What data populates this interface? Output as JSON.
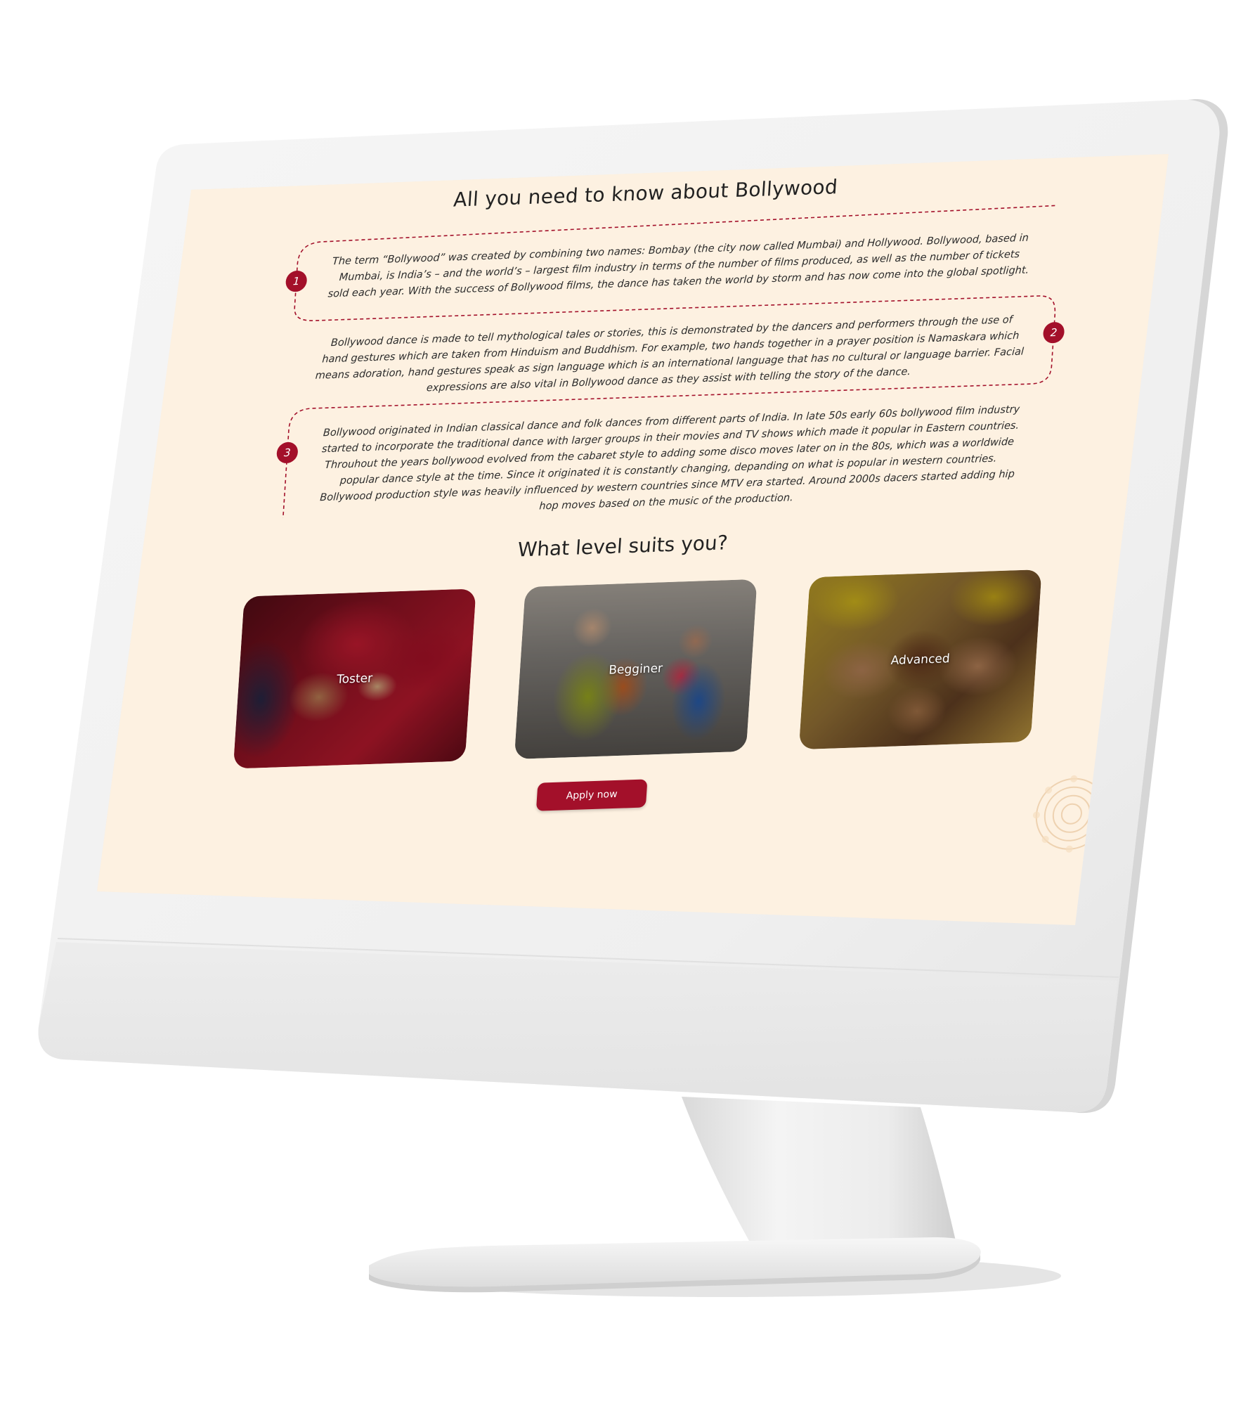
{
  "colors": {
    "background": "#fdf1e1",
    "accent": "#a3102a",
    "text": "#2b2b2b",
    "monitor": "#f1f1f1"
  },
  "page": {
    "title": "All you need to know about Bollywood",
    "steps": [
      {
        "number": "1",
        "text": "The term “Bollywood” was created by combining two names: Bombay (the city now called Mumbai) and Hollywood. Bollywood, based in Mumbai, is India’s – and the world’s – largest film industry in terms of the number of films produced, as well as the number of tickets sold each year. With the success of Bollywood films, the dance has taken the world by storm and has now come into the global spotlight."
      },
      {
        "number": "2",
        "text": "Bollywood dance is made to tell mythological tales or stories, this is demonstrated by the dancers and performers through the use of hand gestures which are taken from Hinduism and Buddhism. For example, two hands together in a prayer position is Namaskara which means adoration, hand gestures speak as sign language which is an international language that has no cultural or language barrier. Facial expressions are also vital in Bollywood dance as they assist with telling the story of the dance."
      },
      {
        "number": "3",
        "text": "Bollywood originated in Indian classical dance and folk dances from different parts of India. In late 50s early 60s bollywood film industry started to incorporate the traditional dance with larger groups in their movies and TV shows which made it popular in Eastern countries. Throuhout the years bollywood evolved from the cabaret style to adding some disco moves later on in the 80s, which was a worldwide popular dance style at the time. Since it originated it is constantly changing, depanding on what is popular in western countries. Bollywood production style was heavily influenced by western countries since MTV era started. Around 2000s dacers started adding hip hop moves based on the music of the production."
      }
    ],
    "levels_title": "What level suits you?",
    "levels": [
      {
        "label": "Toster",
        "image": "henna-hands-red-dress"
      },
      {
        "label": "Begginer",
        "image": "classical-dancers"
      },
      {
        "label": "Advanced",
        "image": "mehndi-hands-circle"
      }
    ],
    "apply_button": "Apply now"
  }
}
